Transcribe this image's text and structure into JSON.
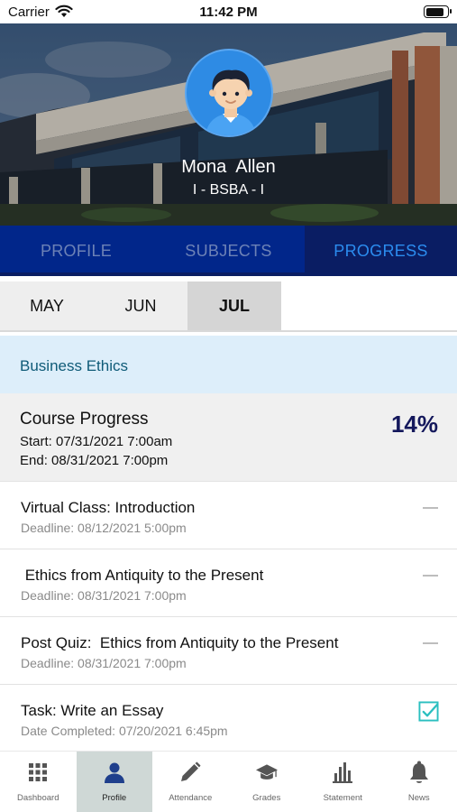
{
  "status_bar": {
    "carrier": "Carrier",
    "time": "11:42 PM",
    "battery_level": 0.85
  },
  "profile": {
    "name": "Mona  Allen",
    "program": "I - BSBA - I"
  },
  "tabs": [
    {
      "label": "PROFILE",
      "active": false
    },
    {
      "label": "SUBJECTS",
      "active": false
    },
    {
      "label": "PROGRESS",
      "active": true
    }
  ],
  "months": [
    {
      "label": "MAY",
      "active": false
    },
    {
      "label": "JUN",
      "active": false
    },
    {
      "label": "JUL",
      "active": true
    }
  ],
  "subject": {
    "title": "Business Ethics"
  },
  "course_progress": {
    "title": "Course Progress",
    "start": "Start: 07/31/2021 7:00am",
    "end": "End: 08/31/2021 7:00pm",
    "percent": "14%"
  },
  "tasks": [
    {
      "title": "Virtual Class: Introduction",
      "subtitle": "Deadline: 08/12/2021 5:00pm",
      "status": "pending"
    },
    {
      "title": " Ethics from Antiquity to the Present",
      "subtitle": "Deadline: 08/31/2021 7:00pm",
      "status": "pending"
    },
    {
      "title": "Post Quiz:  Ethics from Antiquity to the Present",
      "subtitle": "Deadline: 08/31/2021 7:00pm",
      "status": "pending"
    },
    {
      "title": "Task: Write an Essay",
      "subtitle": "Date Completed: 07/20/2021 6:45pm",
      "status": "completed"
    }
  ],
  "bottom_nav": [
    {
      "label": "Dashboard",
      "icon": "dashboard-grid-icon",
      "active": false
    },
    {
      "label": "Profile",
      "icon": "person-icon",
      "active": true
    },
    {
      "label": "Attendance",
      "icon": "pencil-icon",
      "active": false
    },
    {
      "label": "Grades",
      "icon": "graduation-cap-icon",
      "active": false
    },
    {
      "label": "Statement",
      "icon": "bar-chart-icon",
      "active": false
    },
    {
      "label": "News",
      "icon": "bell-icon",
      "active": false
    }
  ],
  "colors": {
    "tab_bar": "#01268a",
    "tab_active_bg": "#0a1d63",
    "tab_active_text": "#2b8cef",
    "percent_text": "#14185c",
    "check_icon": "#2bbfc0"
  }
}
